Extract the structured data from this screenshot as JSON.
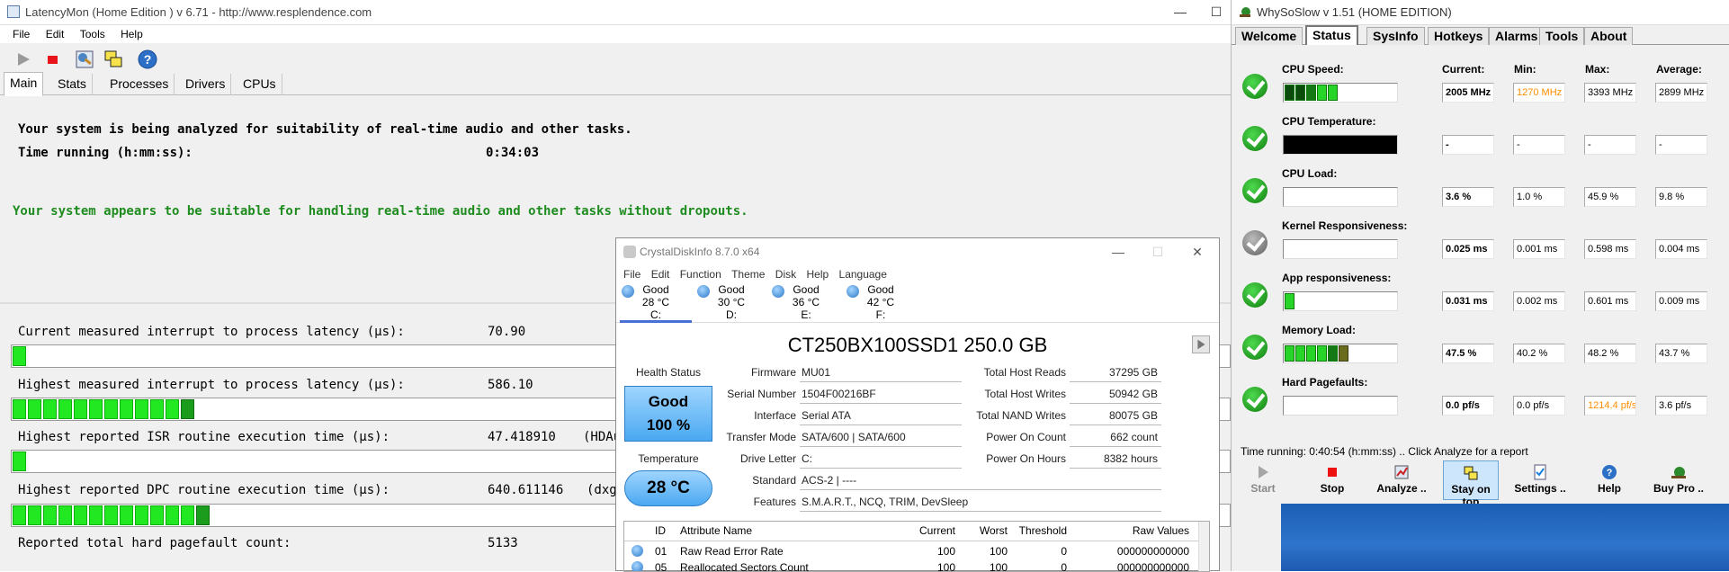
{
  "latencymon": {
    "title": "LatencyMon  (Home Edition ) v 6.71 - http://www.resplendence.com",
    "menu": [
      "File",
      "Edit",
      "Tools",
      "Help"
    ],
    "tabs": [
      "Main",
      "Stats",
      "Processes",
      "Drivers",
      "CPUs"
    ],
    "line1": "Your system is being analyzed for suitability of real-time audio and other tasks.",
    "time_label": "Time running (h:mm:ss):",
    "time_value": "0:34:03",
    "verdict": "Your system appears to be suitable for handling real-time audio and other tasks without dropouts.",
    "metrics": [
      {
        "label": "Current measured interrupt to process latency (µs):",
        "value": "70.90",
        "extra": "",
        "segments": 1
      },
      {
        "label": "Highest measured interrupt to process latency (µs):",
        "value": "586.10",
        "extra": "",
        "segments": 12
      },
      {
        "label": "Highest reported ISR routine execution time (µs):",
        "value": "47.418910",
        "extra": "(HDAu",
        "segments": 1
      },
      {
        "label": "Highest reported DPC routine execution time (µs):",
        "value": "640.611146",
        "extra": "(dxg",
        "segments": 13
      },
      {
        "label": "Reported total hard pagefault count:",
        "value": "5133",
        "extra": "",
        "segments": 0
      }
    ]
  },
  "whysoslow": {
    "title": "WhySoSlow v 1.51  (HOME EDITION)",
    "tabs": [
      "Welcome",
      "Status",
      "SysInfo",
      "Hotkeys",
      "Alarms",
      "Tools",
      "About"
    ],
    "columns": [
      "Current:",
      "Min:",
      "Max:",
      "Average:"
    ],
    "rows": [
      {
        "label": "CPU Speed:",
        "current": "2005 MHz",
        "min": "1270 MHz",
        "max": "3393 MHz",
        "avg": "2899 MHz",
        "min_color": "#ff8c00",
        "max_color": "",
        "status": "green"
      },
      {
        "label": "CPU Temperature:",
        "current": "-",
        "min": "-",
        "max": "-",
        "avg": "-",
        "min_color": "",
        "max_color": "",
        "status": "green"
      },
      {
        "label": "CPU Load:",
        "current": "3.6 %",
        "min": "1.0 %",
        "max": "45.9 %",
        "avg": "9.8 %",
        "min_color": "",
        "max_color": "",
        "status": "green"
      },
      {
        "label": "Kernel Responsiveness:",
        "current": "0.025 ms",
        "min": "0.001 ms",
        "max": "0.598 ms",
        "avg": "0.004 ms",
        "min_color": "",
        "max_color": "",
        "status": "gray"
      },
      {
        "label": "App responsiveness:",
        "current": "0.031 ms",
        "min": "0.002 ms",
        "max": "0.601 ms",
        "avg": "0.009 ms",
        "min_color": "",
        "max_color": "",
        "status": "green"
      },
      {
        "label": "Memory Load:",
        "current": "47.5 %",
        "min": "40.2 %",
        "max": "48.2 %",
        "avg": "43.7 %",
        "min_color": "",
        "max_color": "",
        "status": "green"
      },
      {
        "label": "Hard Pagefaults:",
        "current": "0.0 pf/s",
        "min": "0.0 pf/s",
        "max": "1214.4 pf/s",
        "avg": "3.6 pf/s",
        "min_color": "",
        "max_color": "#ff8c00",
        "status": "green"
      }
    ],
    "status_line": "Time running: 0:40:54  (h:mm:ss) ..  Click Analyze for a report",
    "buttons": [
      "Start",
      "Stop",
      "Analyze ..",
      "Stay on top",
      "Settings ..",
      "Help",
      "Buy Pro .."
    ]
  },
  "crystaldisk": {
    "title": "CrystalDiskInfo 8.7.0 x64",
    "menu": [
      "File",
      "Edit",
      "Function",
      "Theme",
      "Disk",
      "Help",
      "Language"
    ],
    "drives": [
      {
        "status": "Good",
        "temp": "28 °C",
        "letter": "C:"
      },
      {
        "status": "Good",
        "temp": "30 °C",
        "letter": "D:"
      },
      {
        "status": "Good",
        "temp": "36 °C",
        "letter": "E:"
      },
      {
        "status": "Good",
        "temp": "42 °C",
        "letter": "F:"
      }
    ],
    "model": "CT250BX100SSD1 250.0 GB",
    "health_label": "Health Status",
    "health_status": "Good",
    "health_pct": "100 %",
    "temp_label": "Temperature",
    "temp_value": "28 °C",
    "firmware_label": "Firmware",
    "firmware": "MU01",
    "serial_label": "Serial Number",
    "serial": "1504F00216BF",
    "interface_label": "Interface",
    "interface": "Serial ATA",
    "transfer_label": "Transfer Mode",
    "transfer": "SATA/600 | SATA/600",
    "drive_letter_label": "Drive Letter",
    "drive_letter": "C:",
    "standard_label": "Standard",
    "standard": "ACS-2 | ----",
    "features_label": "Features",
    "features": "S.M.A.R.T., NCQ, TRIM, DevSleep",
    "reads_label": "Total Host Reads",
    "reads": "37295 GB",
    "writes_label": "Total Host Writes",
    "writes": "50942 GB",
    "nand_label": "Total NAND Writes",
    "nand": "80075 GB",
    "power_count_label": "Power On Count",
    "power_count": "662 count",
    "power_hours_label": "Power On Hours",
    "power_hours": "8382 hours",
    "attr_headers": [
      "ID",
      "Attribute Name",
      "Current",
      "Worst",
      "Threshold",
      "Raw Values"
    ],
    "attrs": [
      [
        "01",
        "Raw Read Error Rate",
        "100",
        "100",
        "0",
        "000000000000"
      ],
      [
        "05",
        "Reallocated Sectors Count",
        "100",
        "100",
        "0",
        "000000000000"
      ]
    ]
  }
}
